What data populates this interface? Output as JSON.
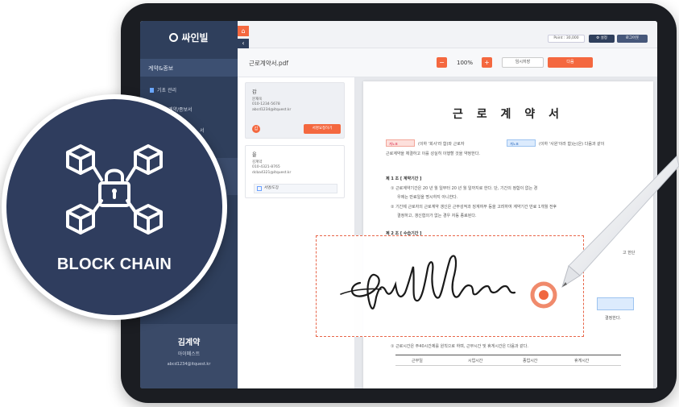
{
  "app": {
    "logo_text": "싸인빌",
    "orange_tab_icon": "home-icon",
    "back_tab": "‹"
  },
  "sidebar": {
    "section_label": "계약&종보",
    "items": [
      {
        "label": "기초 관리"
      },
      {
        "label": "기초 계약/종보서"
      },
      {
        "label": "서"
      }
    ],
    "user": {
      "name": "김계약",
      "company": "아이폐스트",
      "email": "abcd1234@itquest.kr"
    }
  },
  "topbar": {
    "point_label": "Point : 30,000",
    "settings_label": "⚙ 설정",
    "logout_label": "로그아웃"
  },
  "doc_toolbar": {
    "file_name": "근로계약서.pdf",
    "zoom_out": "−",
    "zoom_level": "100%",
    "zoom_in": "+",
    "temp_save": "임시저장",
    "next": "다음"
  },
  "signers": [
    {
      "role": "갑",
      "name": "문재욱",
      "phone": "010-1234-5678",
      "email": "abcd1234@itquest.kr",
      "badge": "갑",
      "request_button": "서명요청하기"
    },
    {
      "role": "을",
      "name": "김계약",
      "phone": "010-4321-8765",
      "email": "dcba4321@itquest.kr",
      "add_sign_label": "서명/도장"
    }
  ],
  "document": {
    "title": "근 로 계 약 서",
    "field_gap": "계노표",
    "field_eul": "계노표",
    "line1_mid": "(이하 '회사'라 함)와 근로자",
    "line1_end": "(이하 '사원'이라 함)는(은) 다음과 같이",
    "line2": "근로계약을 체결하고 이를 성실히 이행할 것을 약정한다.",
    "sec1_title": "제 1 조 [ 계약기간 ]",
    "sec1_l1": "① 근로계약기간은 20 년 월 일부터 20 년 월 일까지로 한다. 단, 기간의 정함이 없는 경",
    "sec1_l2": "우에는 만료일을 명시하지 아니한다.",
    "sec1_l3": "② 기간제 근로자의 근로계약 갱신은 근무성적과 징계여부 등을 고려하여 계약기간 만료 1개월 전후",
    "sec1_l4": "결정하고, 갱신협의가 없는 경우 자동 종료된다.",
    "sec2_title": "제 2 조 [ 수습기간 ]",
    "right_frag1": "고 한단",
    "right_frag2": "결정한다.",
    "sec_work": "① 근로시간은 주40시간제를 원칙으로 하며, 근무시간 및 휴게시간은 다음과 같다.",
    "table_headers": [
      "근무일",
      "시업시간",
      "종업시간",
      "휴게시간"
    ]
  },
  "badge": {
    "label": "BLOCK CHAIN",
    "icon": "blockchain-lock-icon"
  },
  "colors": {
    "accent": "#f4683f",
    "sidebar": "#2f3f5c",
    "badge": "#2f3d5e"
  }
}
